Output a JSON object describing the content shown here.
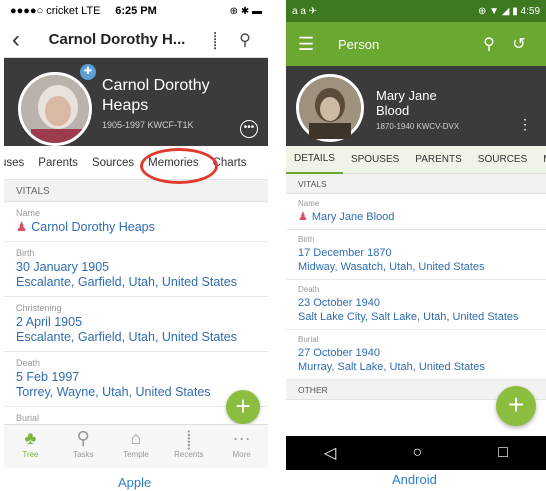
{
  "ios": {
    "status": {
      "left": "●●●●○ cricket  LTE",
      "time": "6:25 PM",
      "right": "⊕ ✱ ▬"
    },
    "nav": {
      "title": "Carnol Dorothy H..."
    },
    "person": {
      "name": "Carnol Dorothy Heaps",
      "dates": "1905-1997  KWCF-T1K"
    },
    "tabs": [
      "uses",
      "Parents",
      "Sources",
      "Memories",
      "Charts"
    ],
    "section_vitals": "VITALS",
    "fields": [
      {
        "label": "Name",
        "value": "Carnol Dorothy Heaps",
        "line2": ""
      },
      {
        "label": "Birth",
        "value": "30 January 1905",
        "line2": "Escalante, Garfield, Utah, United States"
      },
      {
        "label": "Christening",
        "value": "2 April 1905",
        "line2": "Escalante, Garfield, Utah, United States"
      },
      {
        "label": "Death",
        "value": "5 Feb 1997",
        "line2": "Torrey, Wayne, Utah, United States"
      },
      {
        "label": "Burial",
        "value": "",
        "line2": ""
      }
    ],
    "tabbar": [
      {
        "label": "Tree",
        "icon": "tree-icon"
      },
      {
        "label": "Tasks",
        "icon": "tasks-icon"
      },
      {
        "label": "Temple",
        "icon": "temple-icon"
      },
      {
        "label": "Recents",
        "icon": "recents-icon"
      },
      {
        "label": "More",
        "icon": "more-icon"
      }
    ],
    "caption": "Apple"
  },
  "android": {
    "status": {
      "left": "a  a  ✈",
      "right": "⊕ ▼ ◢ ▮ 4:59"
    },
    "toolbar": {
      "title": "Person"
    },
    "person": {
      "name_line1": "Mary Jane",
      "name_line2": "Blood",
      "dates": "1870-1940  KWCV-DVX"
    },
    "tabs": [
      "DETAILS",
      "SPOUSES",
      "PARENTS",
      "SOURCES",
      "ME"
    ],
    "section_vitals": "VITALS",
    "section_other": "OTHER",
    "fields": [
      {
        "label": "Name",
        "value": "Mary Jane Blood",
        "line2": ""
      },
      {
        "label": "Birth",
        "value": "17 December 1870",
        "line2": "Midway, Wasatch, Utah, United States"
      },
      {
        "label": "Death",
        "value": "23 October 1940",
        "line2": "Salt Lake City, Salt Lake, Utah, United States"
      },
      {
        "label": "Burial",
        "value": "27 October 1940",
        "line2": "Murray, Salt Lake, Utah, United States"
      }
    ],
    "caption": "Android"
  }
}
